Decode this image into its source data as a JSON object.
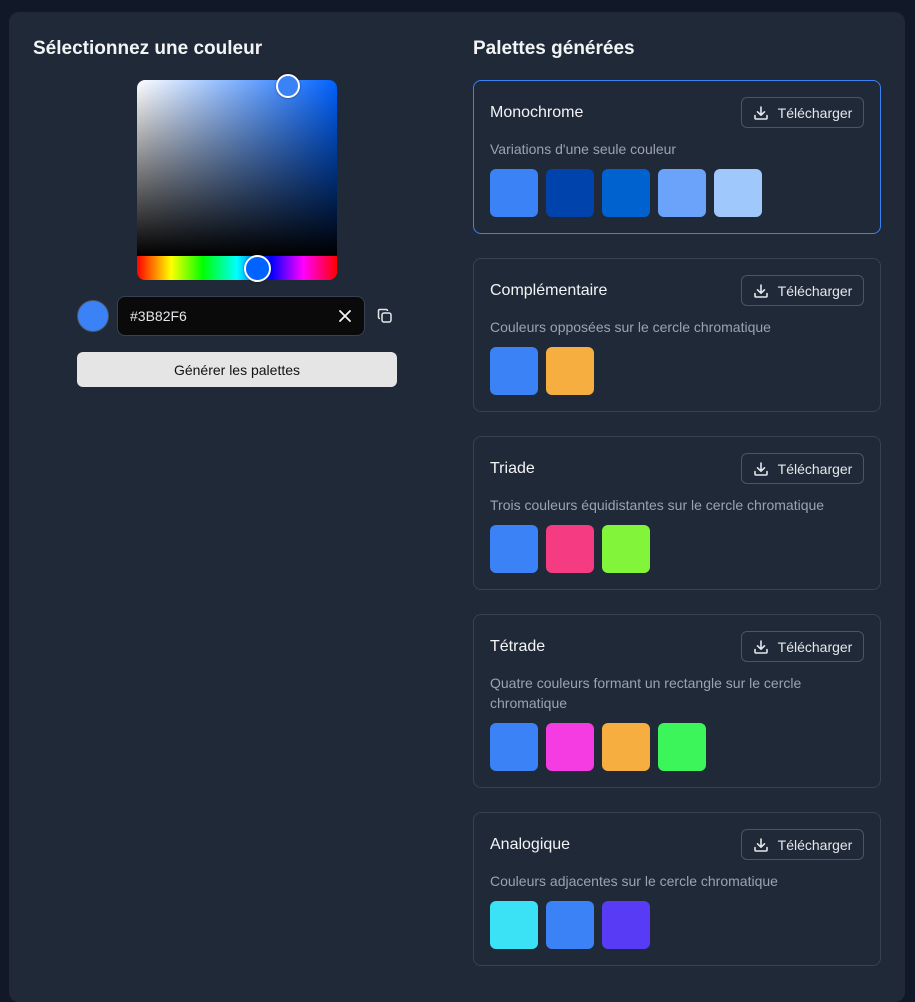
{
  "picker": {
    "title": "Sélectionnez une couleur",
    "hex_value": "#3B82F6",
    "preview_color": "#3B82F6",
    "hue_color": "#0062FF",
    "generate_label": "Générer les palettes"
  },
  "palettes": {
    "title": "Palettes générées",
    "download_label": "Télécharger",
    "items": [
      {
        "name": "Monochrome",
        "description": "Variations d'une seule couleur",
        "colors": [
          "#3B82F6",
          "#0043AD",
          "#0062CF",
          "#6BA3FA",
          "#9FC9FD"
        ]
      },
      {
        "name": "Complémentaire",
        "description": "Couleurs opposées sur le cercle chromatique",
        "colors": [
          "#3B82F6",
          "#F5AE3F"
        ]
      },
      {
        "name": "Triade",
        "description": "Trois couleurs équidistantes sur le cercle chromatique",
        "colors": [
          "#3B82F6",
          "#F53B82",
          "#82F53B"
        ]
      },
      {
        "name": "Tétrade",
        "description": "Quatre couleurs formant un rectangle sur le cercle chromatique",
        "colors": [
          "#3B82F6",
          "#F53BE2",
          "#F5AE3F",
          "#3BF55B"
        ]
      },
      {
        "name": "Analogique",
        "description": "Couleurs adjacentes sur le cercle chromatique",
        "colors": [
          "#3BE2F5",
          "#3B82F6",
          "#573BF5"
        ]
      }
    ]
  }
}
